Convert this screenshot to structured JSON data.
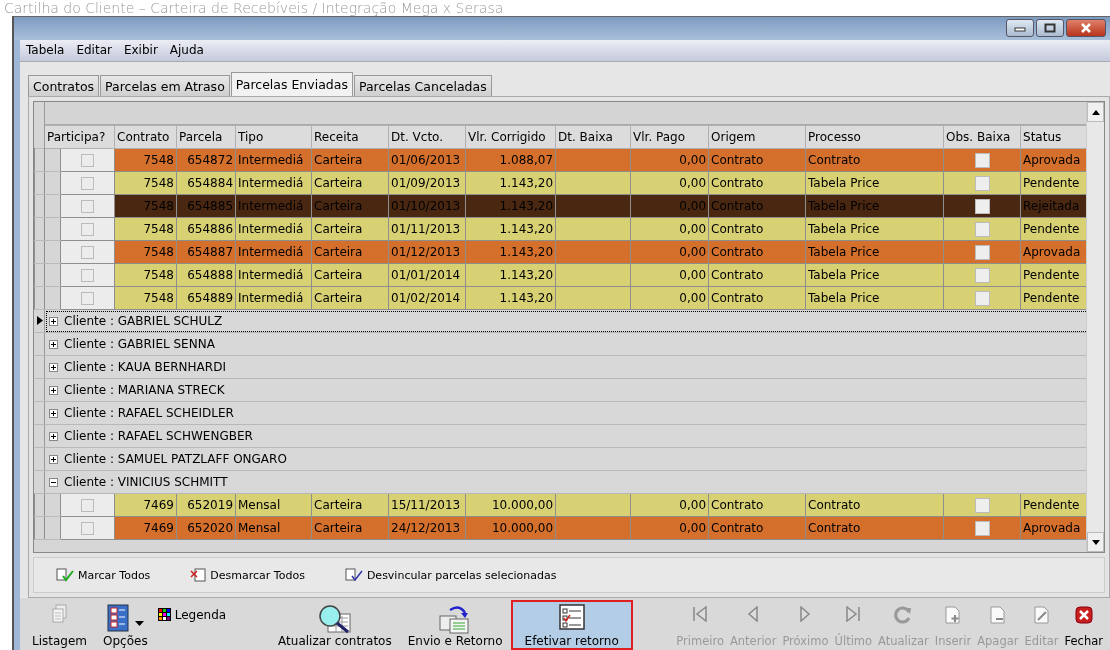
{
  "window": {
    "heading": "Cartilha do Cliente – Carteira de Recebíveis / Integração Mega x Serasa"
  },
  "menu": [
    "Tabela",
    "Editar",
    "Exibir",
    "Ajuda"
  ],
  "tabs": [
    {
      "label": "Contratos",
      "selected": false
    },
    {
      "label": "Parcelas em Atraso",
      "selected": false
    },
    {
      "label": "Parcelas Enviadas",
      "selected": true
    },
    {
      "label": "Parcelas Canceladas",
      "selected": false
    }
  ],
  "table": {
    "columns": [
      "Participa?",
      "Contrato",
      "Parcela",
      "Tipo",
      "Receita",
      "Dt. Vcto.",
      "Vlr. Corrigido",
      "Dt. Baixa",
      "Vlr. Pago",
      "Origem",
      "Processo",
      "Obs. Baixa",
      "Status"
    ],
    "rows": [
      {
        "contrato": "7548",
        "parcela": "654872",
        "tipo": "Intermediá",
        "receita": "Carteira",
        "dt_vcto": "01/06/2013",
        "vlr_corrigido": "1.088,07",
        "vlr_pago": "0,00",
        "origem": "Contrato",
        "processo": "Contrato",
        "status": "Aprovada",
        "participa": false,
        "obs_baixa": false,
        "color": "#d4702c"
      },
      {
        "contrato": "7548",
        "parcela": "654884",
        "tipo": "Intermediá",
        "receita": "Carteira",
        "dt_vcto": "01/09/2013",
        "vlr_corrigido": "1.143,20",
        "vlr_pago": "0,00",
        "origem": "Contrato",
        "processo": "Tabela Price",
        "status": "Pendente",
        "participa": false,
        "obs_baixa": false,
        "color": "#d8d174"
      },
      {
        "contrato": "7548",
        "parcela": "654885",
        "tipo": "Intermediá",
        "receita": "Carteira",
        "dt_vcto": "01/10/2013",
        "vlr_corrigido": "1.143,20",
        "vlr_pago": "0,00",
        "origem": "Contrato",
        "processo": "Tabela Price",
        "status": "Rejeitada",
        "participa": false,
        "obs_baixa": false,
        "color": "#4a2710"
      },
      {
        "contrato": "7548",
        "parcela": "654886",
        "tipo": "Intermediá",
        "receita": "Carteira",
        "dt_vcto": "01/11/2013",
        "vlr_corrigido": "1.143,20",
        "vlr_pago": "0,00",
        "origem": "Contrato",
        "processo": "Tabela Price",
        "status": "Pendente",
        "participa": false,
        "obs_baixa": false,
        "color": "#d8d174"
      },
      {
        "contrato": "7548",
        "parcela": "654887",
        "tipo": "Intermediá",
        "receita": "Carteira",
        "dt_vcto": "01/12/2013",
        "vlr_corrigido": "1.143,20",
        "vlr_pago": "0,00",
        "origem": "Contrato",
        "processo": "Tabela Price",
        "status": "Aprovada",
        "participa": false,
        "obs_baixa": false,
        "color": "#d4702c"
      },
      {
        "contrato": "7548",
        "parcela": "654888",
        "tipo": "Intermediá",
        "receita": "Carteira",
        "dt_vcto": "01/01/2014",
        "vlr_corrigido": "1.143,20",
        "vlr_pago": "0,00",
        "origem": "Contrato",
        "processo": "Tabela Price",
        "status": "Pendente",
        "participa": false,
        "obs_baixa": false,
        "color": "#d8d174"
      },
      {
        "contrato": "7548",
        "parcela": "654889",
        "tipo": "Intermediá",
        "receita": "Carteira",
        "dt_vcto": "01/02/2014",
        "vlr_corrigido": "1.143,20",
        "vlr_pago": "0,00",
        "origem": "Contrato",
        "processo": "Tabela Price",
        "status": "Pendente",
        "participa": false,
        "obs_baixa": false,
        "color": "#d8d174"
      }
    ],
    "clients": [
      {
        "label": "Cliente : GABRIEL SCHULZ",
        "expanded": false,
        "selected": true
      },
      {
        "label": "Cliente : GABRIEL SENNA",
        "expanded": false,
        "selected": false
      },
      {
        "label": "Cliente : KAUA BERNHARDI",
        "expanded": false,
        "selected": false
      },
      {
        "label": "Cliente : MARIANA STRECK",
        "expanded": false,
        "selected": false
      },
      {
        "label": "Cliente : RAFAEL SCHEIDLER",
        "expanded": false,
        "selected": false
      },
      {
        "label": "Cliente : RAFAEL SCHWENGBER",
        "expanded": false,
        "selected": false
      },
      {
        "label": "Cliente : SAMUEL PATZLAFF ONGARO",
        "expanded": false,
        "selected": false
      },
      {
        "label": "Cliente : VINICIUS SCHMITT",
        "expanded": true,
        "selected": false,
        "rows": [
          {
            "contrato": "7469",
            "parcela": "652019",
            "tipo": "Mensal",
            "receita": "Carteira",
            "dt_vcto": "15/11/2013",
            "vlr_corrigido": "10.000,00",
            "vlr_pago": "0,00",
            "origem": "Contrato",
            "processo": "Contrato",
            "status": "Pendente",
            "participa": false,
            "obs_baixa": false,
            "color": "#d8d174"
          },
          {
            "contrato": "7469",
            "parcela": "652020",
            "tipo": "Mensal",
            "receita": "Carteira",
            "dt_vcto": "24/12/2013",
            "vlr_corrigido": "10.000,00",
            "vlr_pago": "0,00",
            "origem": "Contrato",
            "processo": "Contrato",
            "status": "Aprovada",
            "participa": false,
            "obs_baixa": false,
            "color": "#d4702c"
          }
        ]
      }
    ]
  },
  "actions": [
    {
      "label": "Marcar Todos",
      "kind": "mark"
    },
    {
      "label": "Desmarcar Todos",
      "kind": "unmark"
    },
    {
      "label": "Desvincular parcelas selecionadas",
      "kind": "unlink"
    }
  ],
  "toolbar": {
    "left": [
      {
        "label": "Listagem",
        "kind": "list",
        "selected": false
      },
      {
        "label": "Opções",
        "kind": "options",
        "selected": false
      },
      {
        "label": "Legenda",
        "kind": "legend",
        "selected": false
      },
      {
        "label": "Atualizar contratos",
        "kind": "update",
        "selected": false
      },
      {
        "label": "Envio e Retorno",
        "kind": "send",
        "selected": false
      },
      {
        "label": "Efetivar retorno",
        "kind": "confirm",
        "selected": true
      }
    ],
    "nav": [
      {
        "label": "Primeiro",
        "kind": "first",
        "disabled": true
      },
      {
        "label": "Anterior",
        "kind": "prev",
        "disabled": true
      },
      {
        "label": "Próximo",
        "kind": "next",
        "disabled": true
      },
      {
        "label": "Último",
        "kind": "last",
        "disabled": true
      },
      {
        "label": "Atualizar",
        "kind": "refresh",
        "disabled": true
      },
      {
        "label": "Inserir",
        "kind": "insert",
        "disabled": true
      },
      {
        "label": "Apagar",
        "kind": "delete",
        "disabled": true
      },
      {
        "label": "Editar",
        "kind": "edit",
        "disabled": true
      },
      {
        "label": "Fechar",
        "kind": "close",
        "disabled": false
      }
    ]
  }
}
